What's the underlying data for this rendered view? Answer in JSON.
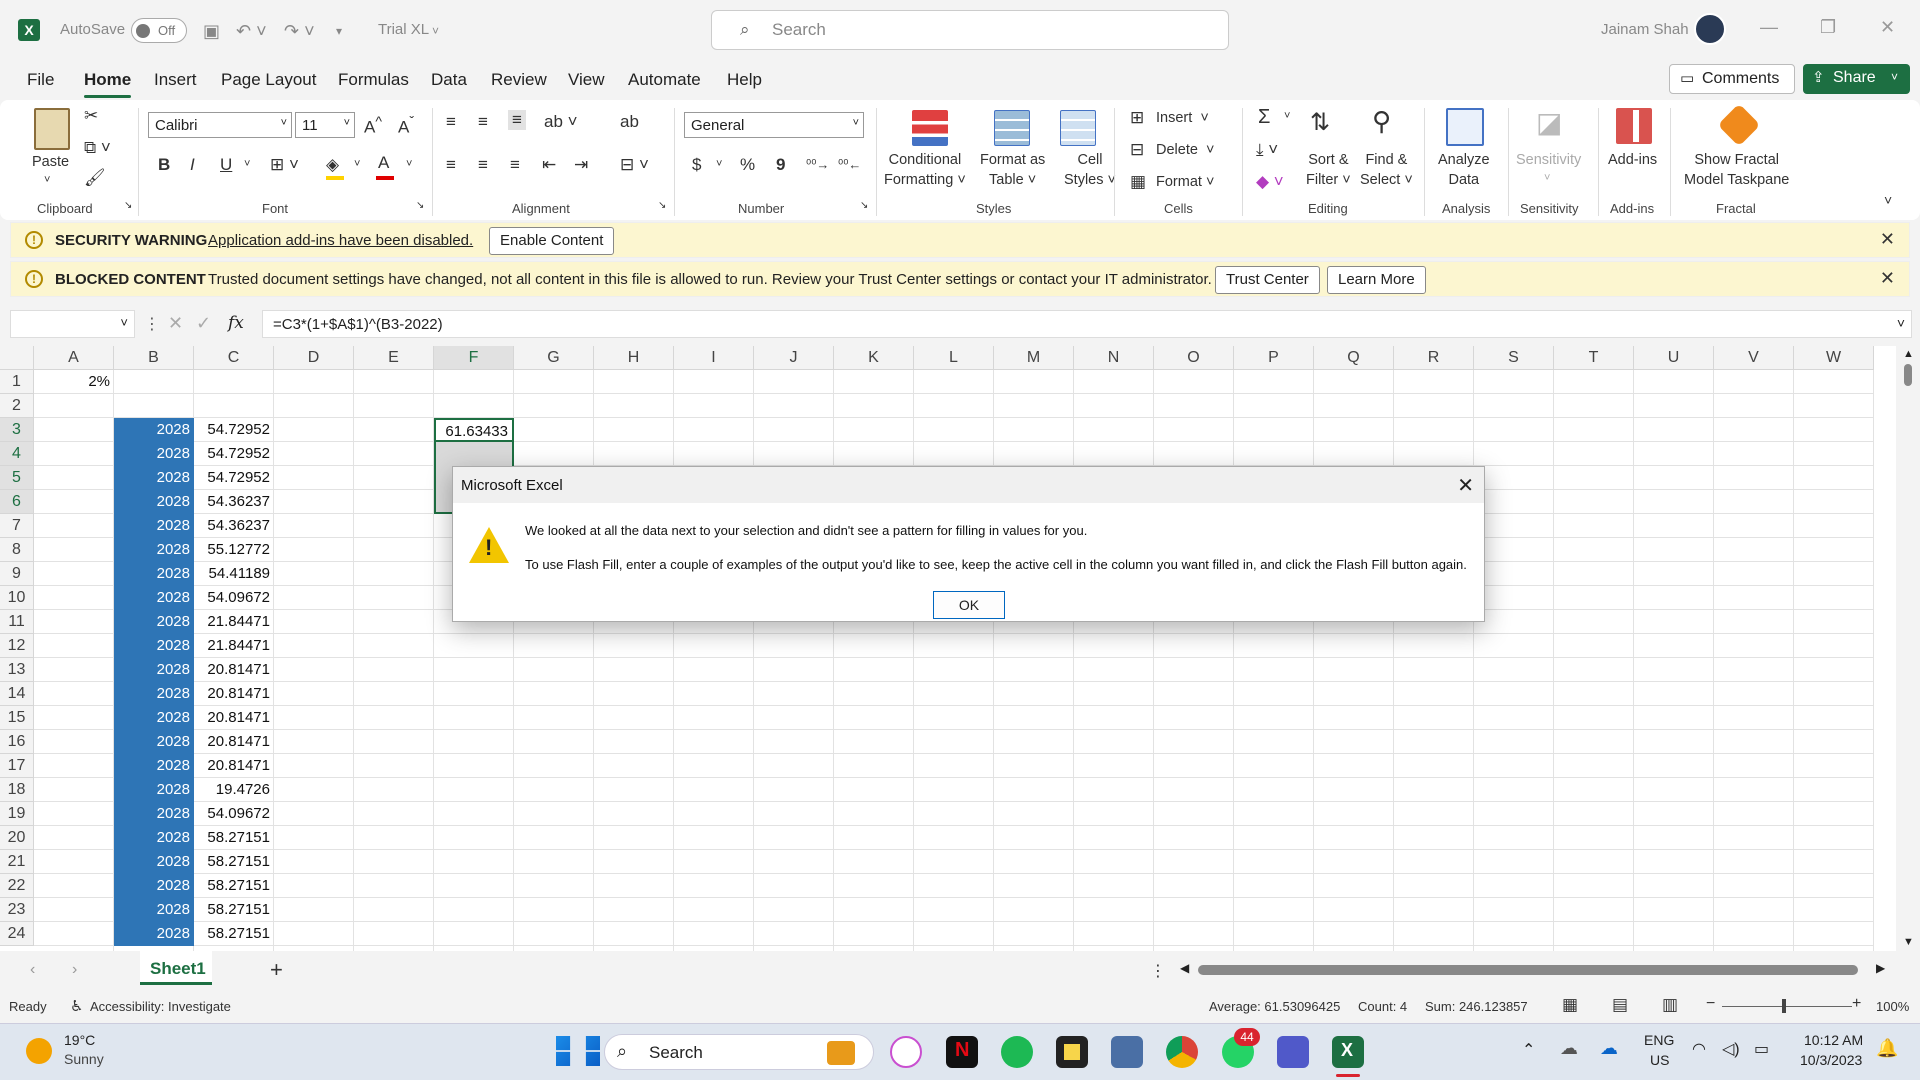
{
  "titlebar": {
    "autosave_label": "AutoSave",
    "autosave_state": "Off",
    "file_name": "Trial XL",
    "search_placeholder": "Search",
    "user_name": "Jainam Shah"
  },
  "menu": {
    "items": [
      "File",
      "Home",
      "Insert",
      "Page Layout",
      "Formulas",
      "Data",
      "Review",
      "View",
      "Automate",
      "Help"
    ],
    "comments": "Comments",
    "share": "Share"
  },
  "ribbon": {
    "clipboard": {
      "paste": "Paste",
      "label": "Clipboard"
    },
    "font": {
      "name": "Calibri",
      "size": "11",
      "label": "Font",
      "bold": "B",
      "italic": "I",
      "underline": "U"
    },
    "alignment": {
      "label": "Alignment"
    },
    "number": {
      "format": "General",
      "label": "Number",
      "currency": "$",
      "percent": "%",
      "comma": "9"
    },
    "styles": {
      "conditional": "Conditional",
      "conditional2": "Formatting",
      "format_table": "Format as",
      "format_table2": "Table",
      "cell_styles": "Cell",
      "cell_styles2": "Styles",
      "label": "Styles"
    },
    "cells": {
      "insert": "Insert",
      "delete": "Delete",
      "format": "Format",
      "label": "Cells"
    },
    "editing": {
      "sort": "Sort &",
      "sort2": "Filter",
      "find": "Find &",
      "find2": "Select",
      "label": "Editing",
      "sigma": "Σ"
    },
    "analysis": {
      "analyze": "Analyze",
      "analyze2": "Data",
      "label": "Analysis"
    },
    "sensitivity": {
      "btn": "Sensitivity",
      "label": "Sensitivity"
    },
    "addins": {
      "btn": "Add-ins",
      "label": "Add-ins"
    },
    "fractal": {
      "btn": "Show Fractal",
      "btn2": "Model Taskpane",
      "label": "Fractal"
    }
  },
  "security_warning": {
    "title": "SECURITY WARNING",
    "message": "Application add-ins have been disabled.",
    "button": "Enable Content"
  },
  "blocked_content": {
    "title": "BLOCKED CONTENT",
    "message": "Trusted document settings have changed, not all content in this file is allowed to run. Review your Trust Center settings or contact your IT administrator.",
    "btn1": "Trust Center",
    "btn2": "Learn More"
  },
  "formula_bar": {
    "fx": "fx",
    "formula": "=C3*(1+$A$1)^(B3-2022)"
  },
  "grid": {
    "columns": [
      "A",
      "B",
      "C",
      "D",
      "E",
      "F",
      "G",
      "H",
      "I",
      "J",
      "K",
      "L",
      "M",
      "N",
      "O",
      "P",
      "Q",
      "R",
      "S",
      "T",
      "U",
      "V",
      "W"
    ],
    "rows": [
      "1",
      "2",
      "3",
      "4",
      "5",
      "6",
      "7",
      "8",
      "9",
      "10",
      "11",
      "12",
      "13",
      "14",
      "15",
      "16",
      "17",
      "18",
      "19",
      "20",
      "21",
      "22",
      "23",
      "24"
    ],
    "a1": "2%",
    "b_values": [
      "2028",
      "2028",
      "2028",
      "2028",
      "2028",
      "2028",
      "2028",
      "2028",
      "2028",
      "2028",
      "2028",
      "2028",
      "2028",
      "2028",
      "2028",
      "2028",
      "2028",
      "2028",
      "2028",
      "2028",
      "2028",
      "2028"
    ],
    "c_values": [
      "54.72952",
      "54.72952",
      "54.72952",
      "54.36237",
      "54.36237",
      "55.12772",
      "54.41189",
      "54.09672",
      "21.84471",
      "21.84471",
      "20.81471",
      "20.81471",
      "20.81471",
      "20.81471",
      "20.81471",
      "19.4726",
      "54.09672",
      "58.27151",
      "58.27151",
      "58.27151",
      "58.27151",
      "58.27151"
    ],
    "f3": "61.63433"
  },
  "sheet_tabs": {
    "active": "Sheet1",
    "add": "+"
  },
  "status": {
    "ready": "Ready",
    "accessibility": "Accessibility: Investigate",
    "average": "Average: 61.53096425",
    "count": "Count: 4",
    "sum": "Sum: 246.123857",
    "zoom": "100%"
  },
  "dialog": {
    "title": "Microsoft Excel",
    "line1": "We looked at all the data next to your selection and didn't see a pattern for filling in values for you.",
    "line2": "To use Flash Fill, enter a couple of examples of the output you'd like to see, keep the active cell in the column you want filled in, and click the Flash Fill button again.",
    "ok": "OK"
  },
  "taskbar": {
    "weather_temp": "19°C",
    "weather_desc": "Sunny",
    "search": "Search",
    "whatsapp_badge": "44",
    "lang1": "ENG",
    "lang2": "US",
    "time": "10:12 AM",
    "date": "10/3/2023"
  }
}
